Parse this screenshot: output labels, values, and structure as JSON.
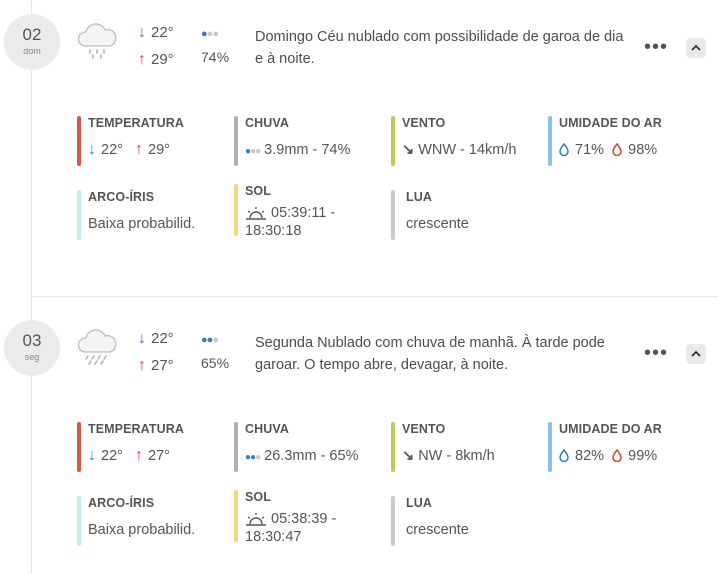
{
  "days": [
    {
      "date": "02",
      "dow": "dom",
      "t_min": "22°",
      "t_max": "29°",
      "rain_level": 1,
      "rain_prob": "74%",
      "summary": "Domingo Céu nublado com possibilidade de garoa de dia e à noite.",
      "weather_icon": "cloud-drizzle-icon",
      "more_label": "•••",
      "metrics": {
        "temp_label": "TEMPERATURA",
        "temp_min": "22°",
        "temp_max": "29°",
        "rain_label": "CHUVA",
        "rain_value": "3.9mm - 74%",
        "wind_label": "VENTO",
        "wind_arrow": "↘",
        "wind_value": "WNW - 14km/h",
        "hum_label": "UMIDADE DO AR",
        "hum_min": "71%",
        "hum_max": "98%",
        "rainbow_label": "ARCO-ÍRIS",
        "rainbow_value": "Baixa probabilid.",
        "sun_label": "SOL",
        "sunrise": "05:39:11 -",
        "sunset": "18:30:18",
        "moon_label": "LUA",
        "moon_value": "crescente"
      }
    },
    {
      "date": "03",
      "dow": "seg",
      "t_min": "22°",
      "t_max": "27°",
      "rain_level": 2,
      "rain_prob": "65%",
      "summary": "Segunda Nublado com chuva de manhã. À tarde pode garoar. O tempo abre, devagar, à noite.",
      "weather_icon": "cloud-rain-icon",
      "more_label": "•••",
      "metrics": {
        "temp_label": "TEMPERATURA",
        "temp_min": "22°",
        "temp_max": "27°",
        "rain_label": "CHUVA",
        "rain_value": "26.3mm - 65%",
        "wind_label": "VENTO",
        "wind_arrow": "↘",
        "wind_value": "NW - 8km/h",
        "hum_label": "UMIDADE DO AR",
        "hum_min": "82%",
        "hum_max": "99%",
        "rainbow_label": "ARCO-ÍRIS",
        "rainbow_value": "Baixa probabilid.",
        "sun_label": "SOL",
        "sunrise": "05:38:39 -",
        "sunset": "18:30:47",
        "moon_label": "LUA",
        "moon_value": "crescente"
      }
    }
  ],
  "colors": {
    "temp_down": "#2f7ec8",
    "temp_up": "#d9413a",
    "bar_temp": "#d9574d",
    "bar_rain": "#b0b0b0",
    "bar_wind": "#b4cf55",
    "bar_humidity": "#86c2ef",
    "bar_rainbow": "#bfeef0",
    "bar_sun": "#f7d77d",
    "bar_moon": "#c3cbd1"
  }
}
